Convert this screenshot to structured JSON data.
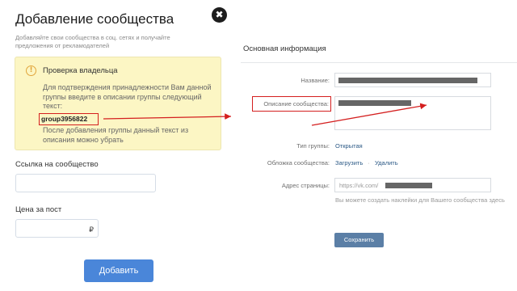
{
  "modal": {
    "title": "Добавление сообщества",
    "close_glyph": "✖",
    "subtitle": "Добавляйте свои сообщества в соц. сетях и получайте предложения от рекламодателей",
    "notice": {
      "icon": "info-icon",
      "icon_glyph": "!",
      "title": "Проверка владельца",
      "text": "Для подтверждения принадлежности Вам данной группы введите в описании группы следующий текст:",
      "code": "group3956822",
      "text_after": "После добавления группы данный текст из описания можно убрать"
    },
    "link_label": "Ссылка на сообщество",
    "link_value": "",
    "price_label": "Цена за пост",
    "price_value": "",
    "currency": "₽",
    "add_button": "Добавить"
  },
  "settings": {
    "section_title": "Основная информация",
    "name_label": "Название:",
    "description_label": "Описание сообщества:",
    "type_label": "Тип группы:",
    "type_value": "Открытая",
    "cover_label": "Обложка сообщества:",
    "cover_upload": "Загрузить",
    "cover_separator": "·",
    "cover_delete": "Удалить",
    "address_label": "Адрес страницы:",
    "address_prefix": "https://vk.com/",
    "address_hint": "Вы можете создать наклейки для Вашего сообщества здесь",
    "save_button": "Сохранить"
  },
  "colors": {
    "accent_blue": "#4a86d9",
    "notice_bg": "#fcf6c4",
    "annotation_red": "#d41f1f",
    "vk_button": "#5b7fa6"
  }
}
